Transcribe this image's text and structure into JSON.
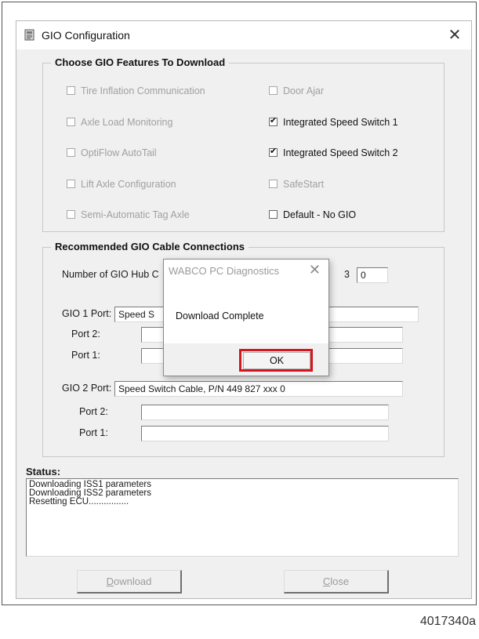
{
  "window": {
    "title": "GIO Configuration",
    "close_glyph": "✕",
    "icon": "gio-config-app-icon"
  },
  "features": {
    "legend": "Choose GIO Features To Download",
    "left": [
      {
        "label": "Tire Inflation Communication",
        "checked": false,
        "enabled": false
      },
      {
        "label": "Axle Load Monitoring",
        "checked": false,
        "enabled": false
      },
      {
        "label": "OptiFlow AutoTail",
        "checked": false,
        "enabled": false
      },
      {
        "label": "Lift Axle Configuration",
        "checked": false,
        "enabled": false
      },
      {
        "label": "Semi-Automatic Tag Axle",
        "checked": false,
        "enabled": false
      }
    ],
    "right": [
      {
        "label": "Door Ajar",
        "checked": false,
        "enabled": false
      },
      {
        "label": "Integrated Speed Switch 1",
        "checked": true,
        "enabled": true
      },
      {
        "label": "Integrated Speed Switch 2",
        "checked": true,
        "enabled": true
      },
      {
        "label": "SafeStart",
        "checked": false,
        "enabled": false
      },
      {
        "label": "Default - No GIO",
        "checked": false,
        "enabled": true
      }
    ]
  },
  "cables": {
    "legend": "Recommended GIO Cable Connections",
    "hub_label": "Number of GIO Hub C",
    "hub_suffix": "3",
    "hub_value": "0",
    "gio1_port_label": "GIO 1 Port:",
    "gio1_port_value": "Speed S",
    "gio1_port2_label": "Port 2:",
    "gio1_port2_value": "",
    "gio1_port1_label": "Port 1:",
    "gio1_port1_value": "",
    "gio2_port_label": "GIO 2 Port:",
    "gio2_port_value": "Speed Switch Cable, P/N 449 827 xxx 0",
    "gio2_port2_label": "Port 2:",
    "gio2_port2_value": "",
    "gio2_port1_label": "Port 1:",
    "gio1_port1_value_2": "",
    "gio2_port1_value": ""
  },
  "status": {
    "label": "Status:",
    "lines": [
      "Downloading ISS1 parameters",
      "Downloading ISS2 parameters",
      "Resetting ECU................"
    ]
  },
  "buttons": {
    "download_mnemonic": "D",
    "download_rest": "ownload",
    "close_mnemonic": "C",
    "close_rest": "lose"
  },
  "dialog": {
    "title": "WABCO PC Diagnostics",
    "close_glyph": "✕",
    "message": "Download Complete",
    "ok_label": "OK",
    "highlight_color": "#d4161e"
  },
  "figure_id": "4017340a"
}
